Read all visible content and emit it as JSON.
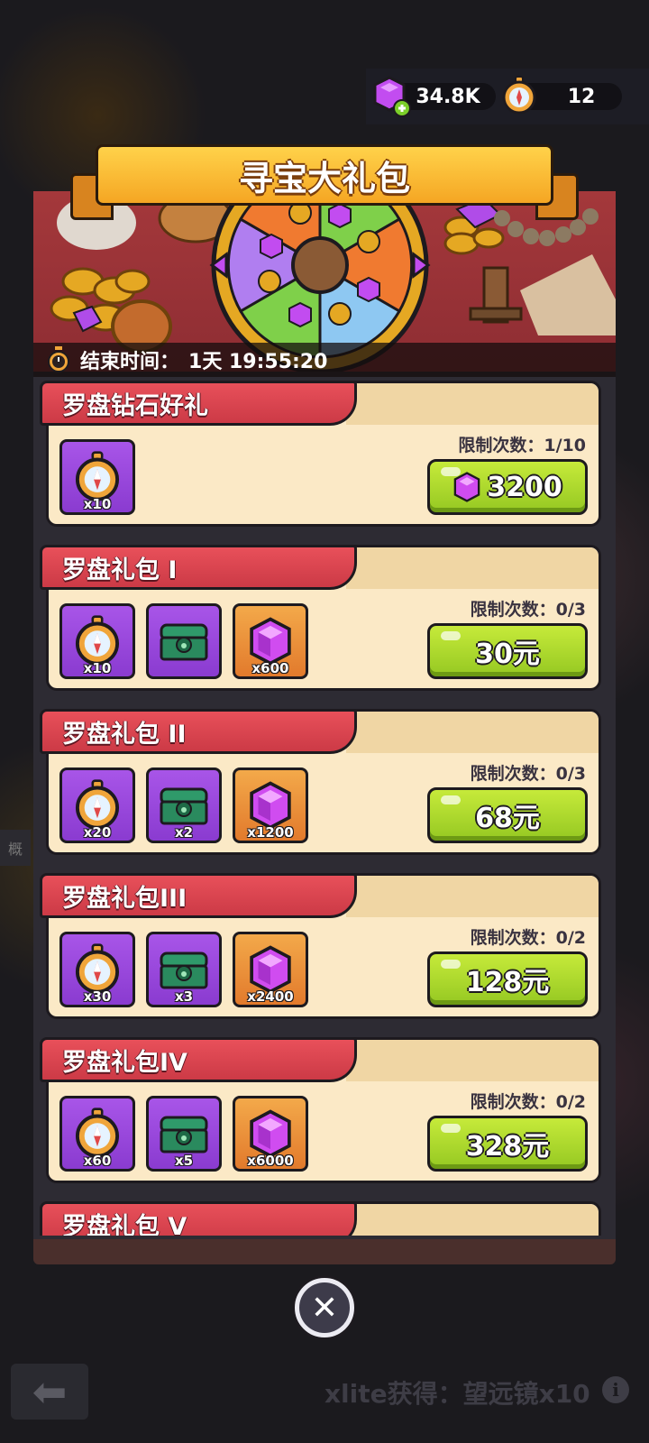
{
  "currency": {
    "gems": {
      "icon": "gem-plus-icon",
      "value": "34.8K"
    },
    "compass": {
      "icon": "compass-icon",
      "value": "12"
    }
  },
  "title": "寻宝大礼包",
  "timer": {
    "label": "结束时间：",
    "value": "1天 19:55:20"
  },
  "side_tag": "概",
  "packs": [
    {
      "name": "罗盘钻石好礼",
      "limit": "限制次数：1/10",
      "price": "3200",
      "price_icon": "gem-icon",
      "items": [
        {
          "type": "compass",
          "count": "x10"
        }
      ]
    },
    {
      "name": "罗盘礼包 I",
      "limit": "限制次数：0/3",
      "price": "30元",
      "items": [
        {
          "type": "compass",
          "count": "x10"
        },
        {
          "type": "chest",
          "count": ""
        },
        {
          "type": "gem",
          "count": "x600"
        }
      ]
    },
    {
      "name": "罗盘礼包 II",
      "limit": "限制次数：0/3",
      "price": "68元",
      "items": [
        {
          "type": "compass",
          "count": "x20"
        },
        {
          "type": "chest",
          "count": "x2"
        },
        {
          "type": "gem",
          "count": "x1200"
        }
      ]
    },
    {
      "name": "罗盘礼包III",
      "limit": "限制次数：0/2",
      "price": "128元",
      "items": [
        {
          "type": "compass",
          "count": "x30"
        },
        {
          "type": "chest",
          "count": "x3"
        },
        {
          "type": "gem",
          "count": "x2400"
        }
      ]
    },
    {
      "name": "罗盘礼包IV",
      "limit": "限制次数：0/2",
      "price": "328元",
      "items": [
        {
          "type": "compass",
          "count": "x60"
        },
        {
          "type": "chest",
          "count": "x5"
        },
        {
          "type": "gem",
          "count": "x6000"
        }
      ]
    },
    {
      "name": "罗盘礼包 V",
      "limit": "",
      "price": "",
      "items": []
    }
  ],
  "close": {
    "icon": "close-icon"
  },
  "back": {
    "icon": "back-arrow-icon"
  },
  "ticker": "xlite获得：望远镜x10"
}
